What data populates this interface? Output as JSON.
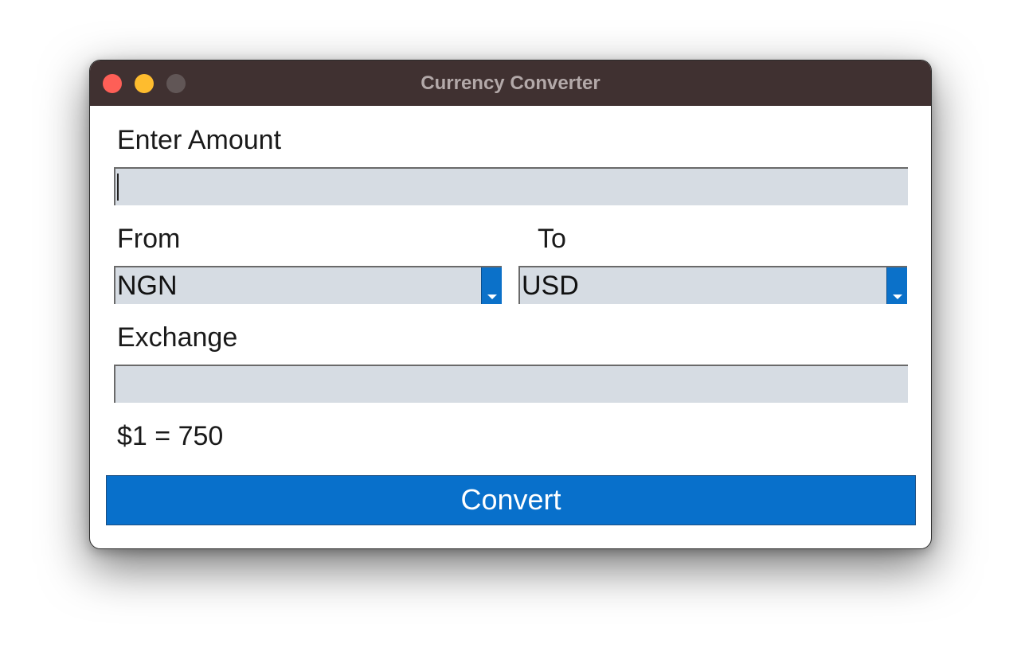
{
  "window": {
    "title": "Currency Converter"
  },
  "form": {
    "amount_label": "Enter Amount",
    "amount_value": "",
    "from_label": "From",
    "to_label": "To",
    "from_value": "NGN",
    "to_value": "USD",
    "exchange_label": "Exchange",
    "exchange_value": "",
    "rate_text": "$1 = 750",
    "convert_label": "Convert"
  },
  "icons": {
    "close": "close-icon",
    "minimize": "minimize-icon",
    "maximize": "maximize-icon",
    "dropdown": "chevron-down-icon"
  },
  "colors": {
    "titlebar": "#403131",
    "accent": "#0870cb",
    "field_bg": "#d6dce3"
  }
}
